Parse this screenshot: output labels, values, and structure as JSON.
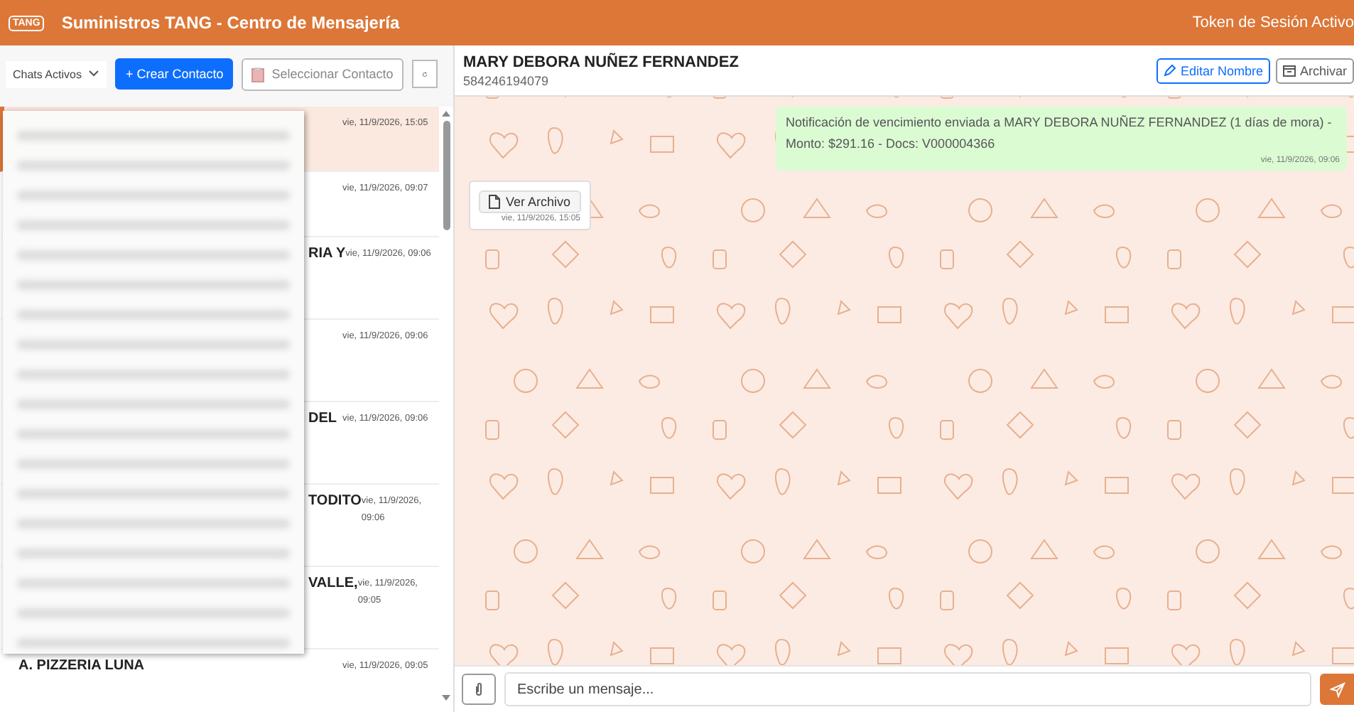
{
  "header": {
    "logo": "TANG",
    "title": "Suministros TANG - Centro de Mensajería",
    "status": "Token de Sesión Activo"
  },
  "sidebar": {
    "filter": "Chats Activos",
    "create_button": "+ Crear Contacto",
    "select_button": "Seleccionar Contacto",
    "chats": [
      {
        "time": "vie, 11/9/2026, 15:05",
        "selected": true
      },
      {
        "time": "vie, 11/9/2026, 09:07",
        "selected": false
      },
      {
        "name": "RIA Y",
        "time": "vie, 11/9/2026, 09:06",
        "selected": false,
        "covered": true
      },
      {
        "time": "vie, 11/9/2026, 09:06",
        "selected": false
      },
      {
        "name": "DEL",
        "time": "vie, 11/9/2026, 09:06",
        "selected": false,
        "covered": true
      },
      {
        "name": "TODITO",
        "time": "vie, 11/9/2026, 09:06",
        "selected": false,
        "covered": true
      },
      {
        "name": "VALLE,",
        "time": "vie, 11/9/2026, 09:05",
        "selected": false,
        "covered": true
      },
      {
        "name": "A. PIZZERIA LUNA",
        "time": "vie, 11/9/2026, 09:05",
        "selected": false,
        "covered": false
      }
    ]
  },
  "chat": {
    "contact_name": "MARY DEBORA NUÑEZ FERNANDEZ",
    "phone": "584246194079",
    "edit_button": "Editar Nombre",
    "archive_button": "Archivar",
    "messages": [
      {
        "kind": "text",
        "text": "Notificación de vencimiento enviada a MARY DEBORA NUÑEZ FERNANDEZ (1 días de mora) - Monto: $291.16 - Docs: V000004366",
        "time": "vie, 11/9/2026, 09:06"
      },
      {
        "kind": "file",
        "text": "Ver Archivo",
        "time": "vie, 11/9/2026, 15:05"
      }
    ],
    "composer": {
      "placeholder": "Escribe un mensaje..."
    }
  }
}
